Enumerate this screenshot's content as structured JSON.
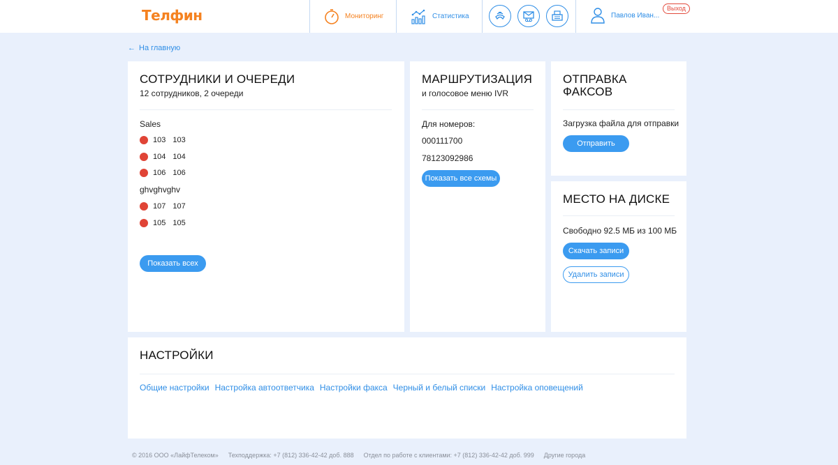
{
  "header": {
    "logo": "Телфин",
    "nav": {
      "monitoring": "Мониторинг",
      "statistics": "Статистика"
    },
    "user_name": "Павлов Иван...",
    "logout": "Выход"
  },
  "back_link": "На главную",
  "employees": {
    "title": "СОТРУДНИКИ И ОЧЕРЕДИ",
    "subtitle": "12 сотрудников, 2 очереди",
    "queues": [
      {
        "name": "Sales",
        "members": [
          {
            "num": "103",
            "name": "103",
            "status_color": "#e04436"
          },
          {
            "num": "104",
            "name": "104",
            "status_color": "#e04436"
          },
          {
            "num": "106",
            "name": "106",
            "status_color": "#e04436"
          }
        ]
      },
      {
        "name": "ghvghvghv",
        "members": [
          {
            "num": "107",
            "name": "107",
            "status_color": "#e04436"
          },
          {
            "num": "105",
            "name": "105",
            "status_color": "#e04436"
          }
        ]
      }
    ],
    "show_all_button": "Показать всех"
  },
  "routing": {
    "title": "МАРШРУТИЗАЦИЯ",
    "subtitle": "и голосовое меню IVR",
    "numbers_label": "Для номеров:",
    "numbers": [
      "000111700",
      "78123092986"
    ],
    "show_schemes_button": "Показать все схемы"
  },
  "fax": {
    "title_line1": "ОТПРАВКА",
    "title_line2": "ФАКСОВ",
    "upload_label": "Загрузка файла для отправки",
    "send_button": "Отправить"
  },
  "disk": {
    "title": "МЕСТО НА ДИСКЕ",
    "free_text": "Свободно 92.5 МБ из 100 МБ",
    "download_button": "Скачать записи",
    "delete_button": "Удалить записи"
  },
  "settings": {
    "title": "НАСТРОЙКИ",
    "links": [
      "Общие настройки",
      "Настройка автоответчика",
      "Настройки факса",
      "Черный и белый списки",
      "Настройка оповещений"
    ]
  },
  "footer": {
    "copyright": "© 2016 ООО «ЛайфТелеком»",
    "support": "Техподдержка: +7 (812) 336-42-42 доб. 888",
    "clients": "Отдел по работе с клиентами: +7 (812) 336-42-42 доб. 999",
    "cities": "Другие города"
  },
  "colors": {
    "accent": "#3b9bf0",
    "brand": "#f58220",
    "offline": "#e04436",
    "background": "#e9f0fc"
  }
}
